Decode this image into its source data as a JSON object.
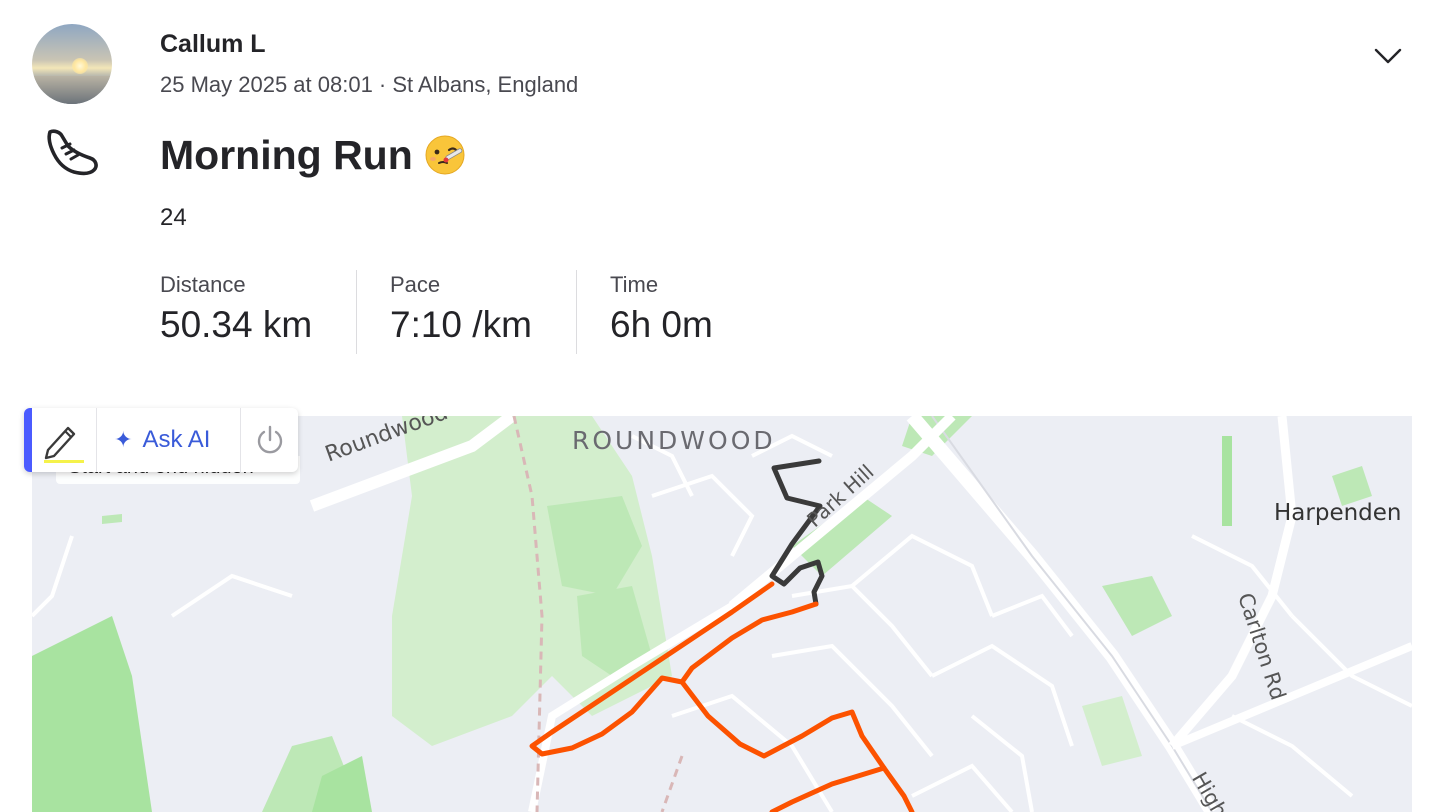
{
  "athlete": {
    "name": "Callum L",
    "meta": "25 May 2025 at 08:01 · St Albans, England"
  },
  "activity": {
    "sport_icon": "running-shoe-icon",
    "title": "Morning Run",
    "emoji": "face-with-thermometer",
    "description": "24"
  },
  "stats": [
    {
      "label": "Distance",
      "value": "50.34 km"
    },
    {
      "label": "Pace",
      "value": "7:10 /km"
    },
    {
      "label": "Time",
      "value": "6h 0m"
    }
  ],
  "toolbar": {
    "edit_icon": "pencil-icon",
    "ask_ai_label": "Ask AI",
    "ask_ai_icon": "sparkle-icon",
    "power_icon": "power-icon",
    "tooltip_text": "Start and end hidden",
    "accent_color": "#4b5bff"
  },
  "map": {
    "labels": {
      "area": "ROUNDWOOD",
      "road_roundwood": "Roundwood Ln",
      "road_park_hill": "Park Hill",
      "town": "Harpenden",
      "road_carlton": "Carlton Rd",
      "road_high": "High"
    },
    "route_color": "#fc5200",
    "hidden_route_color": "#3a3a3a"
  },
  "menu_icon": "chevron-down-icon"
}
